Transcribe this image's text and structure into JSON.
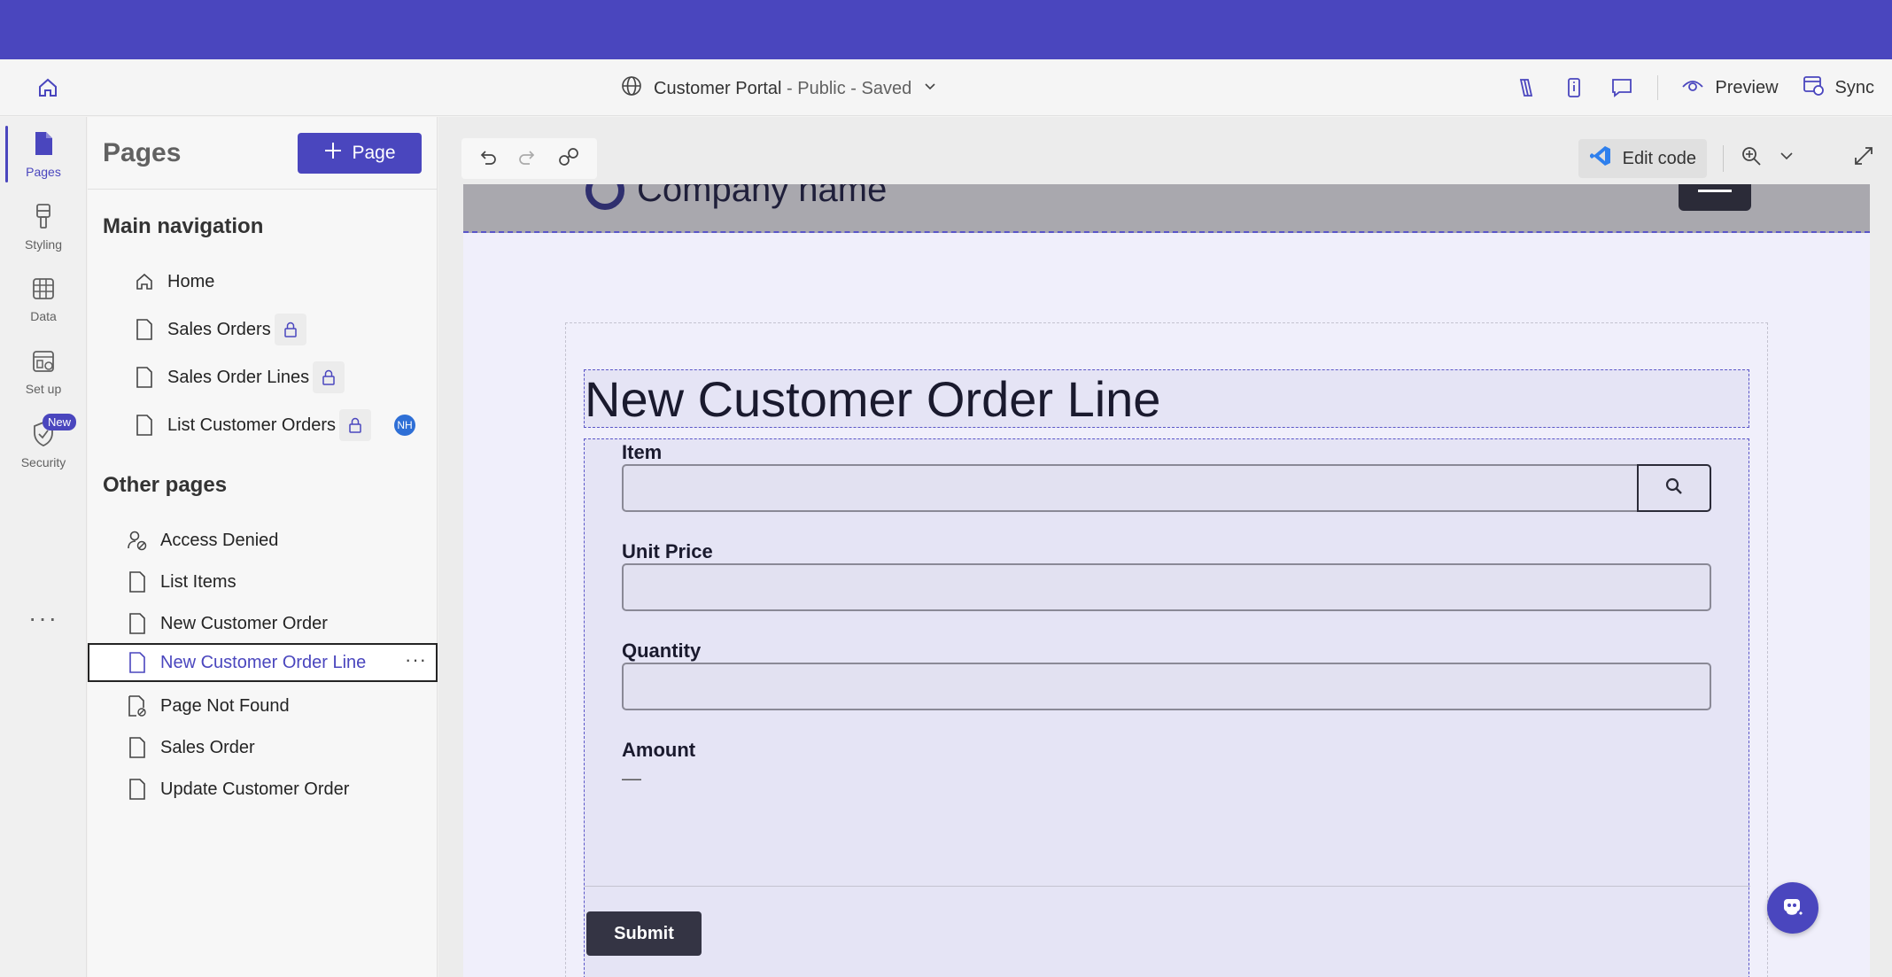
{
  "app": {
    "site_name": "Customer Portal",
    "site_status": " - Public - Saved",
    "accent_color": "#4a46be"
  },
  "commandbar": {
    "preview_label": "Preview",
    "sync_label": "Sync"
  },
  "rail": {
    "items": [
      {
        "label": "Pages",
        "icon": "page-icon"
      },
      {
        "label": "Styling",
        "icon": "paintbrush-icon"
      },
      {
        "label": "Data",
        "icon": "table-icon"
      },
      {
        "label": "Set up",
        "icon": "setup-icon"
      },
      {
        "label": "Security",
        "icon": "shield-icon"
      }
    ],
    "new_badge": "New",
    "more": "···"
  },
  "pages_panel": {
    "title": "Pages",
    "add_button": "Page",
    "main_nav_title": "Main navigation",
    "main_nav": [
      {
        "label": "Home"
      },
      {
        "label": "Sales Orders"
      },
      {
        "label": "Sales Order Lines"
      },
      {
        "label": "List Customer Orders",
        "avatar": "NH"
      }
    ],
    "other_title": "Other pages",
    "other_pages": [
      {
        "label": "Access Denied"
      },
      {
        "label": "List Items"
      },
      {
        "label": "New Customer Order"
      },
      {
        "label": "New Customer Order Line"
      },
      {
        "label": "Page Not Found"
      },
      {
        "label": "Sales Order"
      },
      {
        "label": "Update Customer Order"
      }
    ],
    "selected_more": "···"
  },
  "canvas": {
    "edit_code_label": "Edit code"
  },
  "preview": {
    "company_name": "Company name",
    "form_title": "New Customer Order Line",
    "fields": {
      "item_label": "Item",
      "unit_price_label": "Unit Price",
      "quantity_label": "Quantity",
      "amount_label": "Amount",
      "amount_value": "—"
    },
    "submit_label": "Submit"
  }
}
